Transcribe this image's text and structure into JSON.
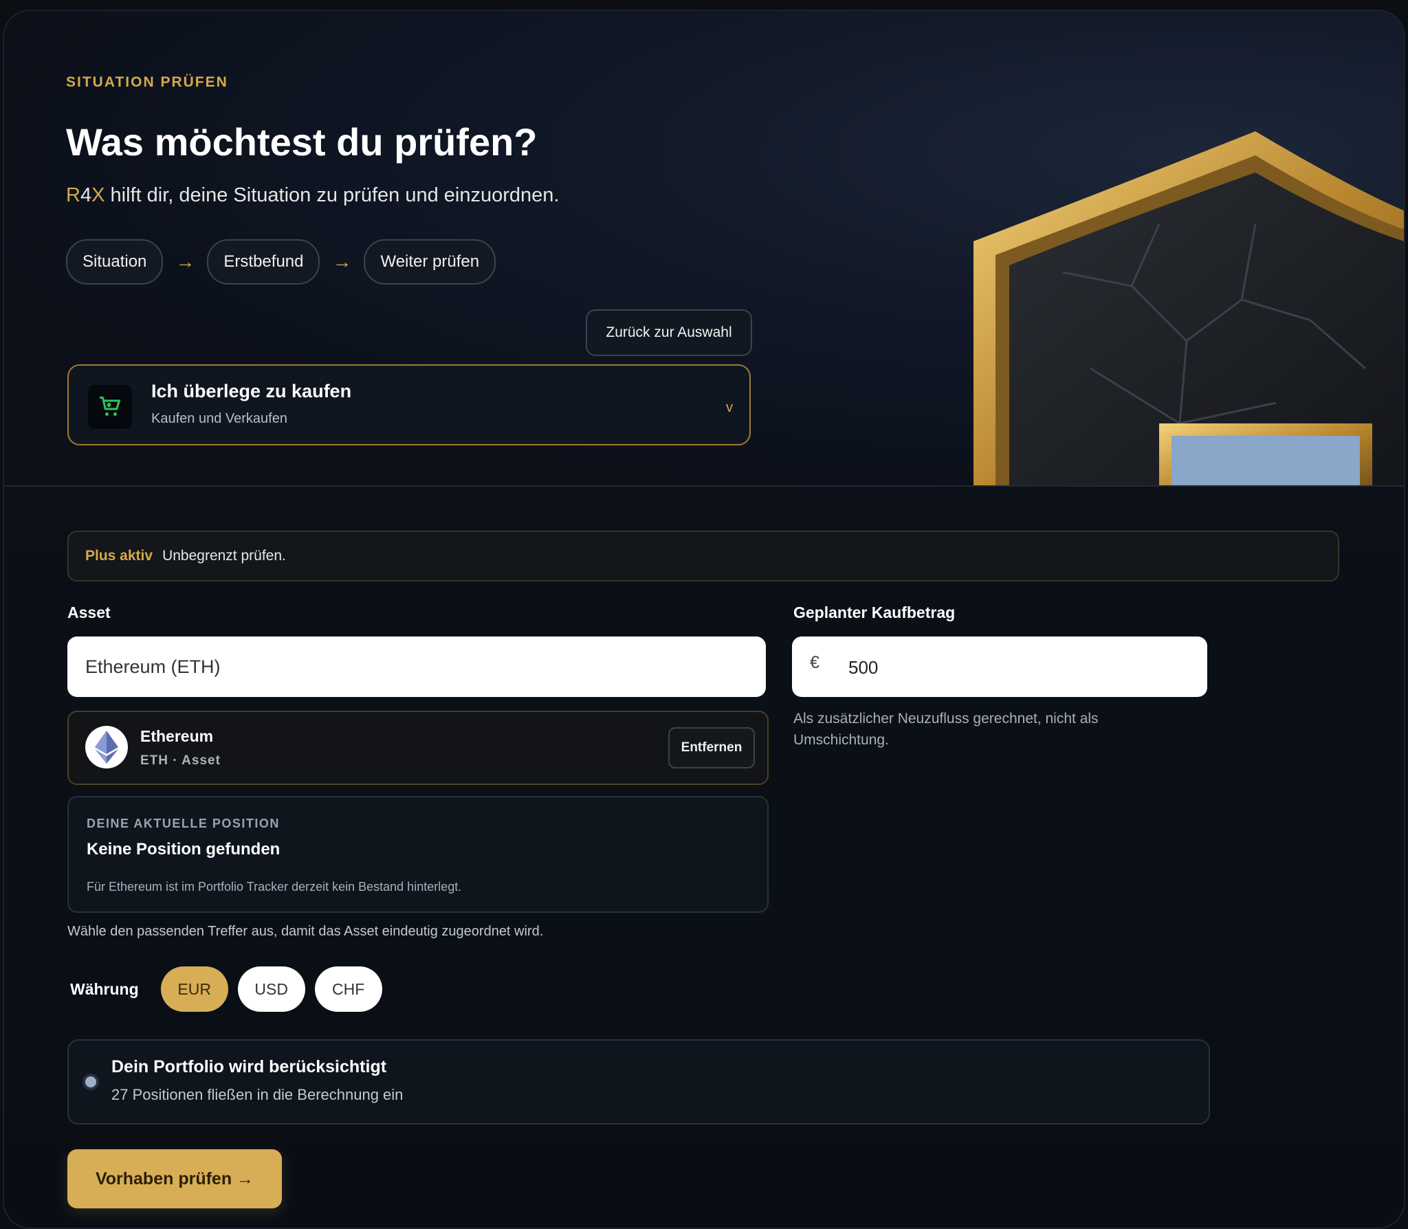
{
  "hero": {
    "eyebrow": "SITUATION PRÜFEN",
    "title": "Was möchtest du prüfen?",
    "subtitle_brand_r": "R",
    "subtitle_brand_4": "4",
    "subtitle_brand_x": "X",
    "subtitle_rest": " hilft dir, deine Situation zu prüfen und einzuordnen.",
    "steps": [
      "Situation",
      "Erstbefund",
      "Weiter prüfen"
    ],
    "arrow": "→",
    "back_button": "Zurück zur Auswahl",
    "select": {
      "title": "Ich überlege zu kaufen",
      "subtitle": "Kaufen und Verkaufen",
      "chevron": "v",
      "icon": "cart-icon"
    }
  },
  "plus": {
    "label": "Plus aktiv",
    "text": "Unbegrenzt prüfen."
  },
  "asset": {
    "label": "Asset",
    "input_value": "Ethereum (ETH)",
    "selected": {
      "name": "Ethereum",
      "meta": "ETH · Asset",
      "icon": "ethereum-icon",
      "remove_label": "Entfernen"
    },
    "position": {
      "eyebrow": "DEINE AKTUELLE POSITION",
      "title": "Keine Position gefunden",
      "text": "Für Ethereum ist im Portfolio Tracker derzeit kein Bestand hinterlegt."
    },
    "hint": "Wähle den passenden Treffer aus, damit das Asset eindeutig zugeordnet wird."
  },
  "amount": {
    "label": "Geplanter Kaufbetrag",
    "currency_symbol": "€",
    "value": "500",
    "note": "Als zusätzlicher Neuzufluss gerechnet, nicht als Umschichtung."
  },
  "currency": {
    "label": "Währung",
    "options": [
      "EUR",
      "USD",
      "CHF"
    ],
    "selected": "EUR"
  },
  "portfolio": {
    "title": "Dein Portfolio wird berücksichtigt",
    "subtitle": "27 Positionen fließen in die Berechnung ein"
  },
  "cta": {
    "label": "Vorhaben prüfen →"
  },
  "colors": {
    "accent": "#d7ae56",
    "background": "#0b0e13"
  }
}
